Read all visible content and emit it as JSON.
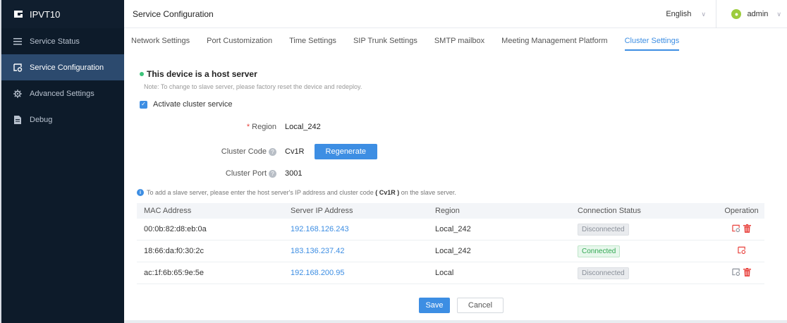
{
  "app": {
    "name": "IPVT10"
  },
  "sidebar": {
    "items": [
      {
        "label": "Service Status",
        "icon": "list-icon"
      },
      {
        "label": "Service Configuration",
        "icon": "config-icon",
        "active": true
      },
      {
        "label": "Advanced Settings",
        "icon": "gear-icon"
      },
      {
        "label": "Debug",
        "icon": "document-icon"
      }
    ]
  },
  "header": {
    "title": "Service Configuration",
    "language": "English",
    "user": "admin"
  },
  "tabs": [
    {
      "label": "Network Settings"
    },
    {
      "label": "Port Customization"
    },
    {
      "label": "Time Settings"
    },
    {
      "label": "SIP Trunk Settings"
    },
    {
      "label": "SMTP mailbox"
    },
    {
      "label": "Meeting Management Platform"
    },
    {
      "label": "Cluster Settings",
      "active": true
    }
  ],
  "cluster": {
    "host_title": "This device is a host server",
    "note": "Note: To change to slave server, please factory reset the device and redeploy.",
    "activate_label": "Activate cluster service",
    "activate_checked": true,
    "region_label": "Region",
    "region_value": "Local_242",
    "code_label": "Cluster Code",
    "code_value": "Cv1R",
    "regenerate_label": "Regenerate",
    "port_label": "Cluster Port",
    "port_value": "3001",
    "info_prefix": "To add a slave server, please enter the host server's IP address and cluster code",
    "info_code": "( Cv1R )",
    "info_suffix": "on the slave server."
  },
  "table": {
    "headers": [
      "MAC Address",
      "Server IP Address",
      "Region",
      "Connection Status",
      "Operation"
    ],
    "rows": [
      {
        "mac": "00:0b:82:d8:eb:0a",
        "ip": "192.168.126.243",
        "region": "Local_242",
        "status": "Disconnected"
      },
      {
        "mac": "18:66:da:f0:30:2c",
        "ip": "183.136.237.42",
        "region": "Local_242",
        "status": "Connected"
      },
      {
        "mac": "ac:1f:6b:65:9e:5e",
        "ip": "192.168.200.95",
        "region": "Local",
        "status": "Disconnected"
      }
    ]
  },
  "footer": {
    "save_label": "Save",
    "cancel_label": "Cancel"
  },
  "colors": {
    "accent": "#3d8ee3",
    "sidebar_bg": "#0d1b2a",
    "active_nav": "#2c4a6e",
    "connected": "#32a852",
    "delete": "#e8413c"
  }
}
